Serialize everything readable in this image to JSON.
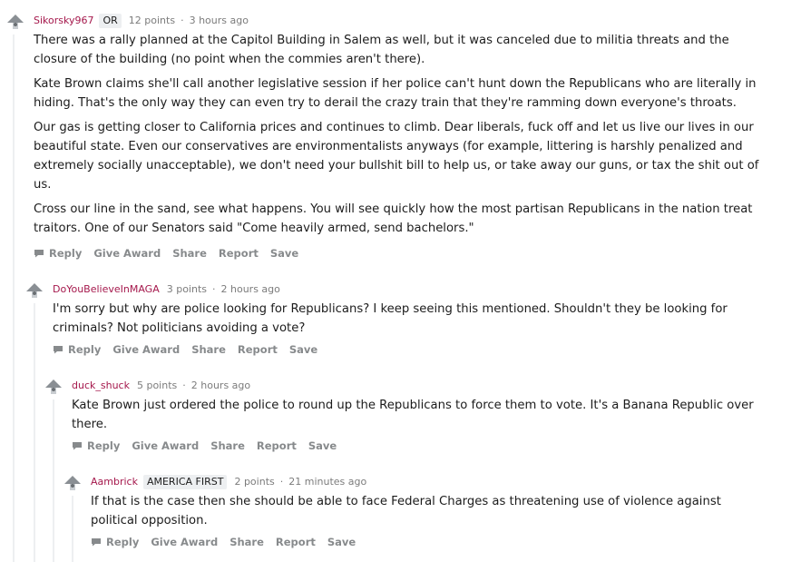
{
  "comments": [
    {
      "author": "Sikorsky967",
      "flair": "OR",
      "points": "12 points",
      "time": "3 hours ago",
      "paragraphs": [
        "There was a rally planned at the Capitol Building in Salem as well, but it was canceled due to militia threats and the closure of the building (no point when the commies aren't there).",
        "Kate Brown claims she'll call another legislative session if her police can't hunt down the Republicans who are literally in hiding. That's the only way they can even try to derail the crazy train that they're ramming down everyone's throats.",
        "Our gas is getting closer to California prices and continues to climb. Dear liberals, fuck off and let us live our lives in our beautiful state. Even our conservatives are environmentalists anyways (for example, littering is harshly penalized and extremely socially unacceptable), we don't need your bullshit bill to help us, or take away our guns, or tax the shit out of us.",
        "Cross our line in the sand, see what happens. You will see quickly how the most partisan Republicans in the nation treat traitors. One of our Senators said \"Come heavily armed, send bachelors.\""
      ]
    },
    {
      "author": "DoYouBelieveInMAGA",
      "points": "3 points",
      "time": "2 hours ago",
      "paragraphs": [
        "I'm sorry but why are police looking for Republicans? I keep seeing this mentioned. Shouldn't they be looking for criminals? Not politicians avoiding a vote?"
      ]
    },
    {
      "author": "duck_shuck",
      "points": "5 points",
      "time": "2 hours ago",
      "paragraphs": [
        "Kate Brown just ordered the police to round up the Republicans to force them to vote. It's a Banana Republic over there."
      ]
    },
    {
      "author": "Aambrick",
      "flair": "AMERICA FIRST",
      "points": "2 points",
      "time": "21 minutes ago",
      "paragraphs": [
        "If that is the case then she should be able to face Federal Charges as threatening use of violence against political opposition."
      ]
    }
  ],
  "actions": {
    "reply": "Reply",
    "give_award": "Give Award",
    "share": "Share",
    "report": "Report",
    "save": "Save"
  },
  "separator": "·",
  "icons": {
    "avatar": "snoo-avatar-icon",
    "reply": "speech-bubble-icon"
  },
  "colors": {
    "author": "#a5184c",
    "meta": "#7c7c7c",
    "action": "#878a8c",
    "thread_line": "#edeff1",
    "flair_bg": "#edeff1"
  }
}
